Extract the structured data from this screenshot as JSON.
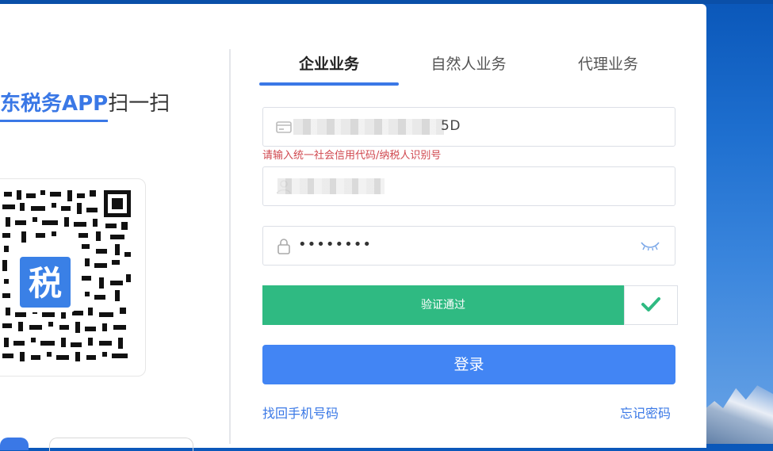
{
  "left_panel": {
    "brand_text": "东税务APP",
    "scan_text": "扫一扫",
    "qr_badge_glyph": "税"
  },
  "tabs": [
    {
      "label": "企业业务",
      "active": true
    },
    {
      "label": "自然人业务",
      "active": false
    },
    {
      "label": "代理业务",
      "active": false
    }
  ],
  "form": {
    "credit_code": {
      "icon": "id-card-icon",
      "visible_value_suffix": "5D"
    },
    "credit_code_error": "请输入统一社会信用代码/纳税人识别号",
    "username": {
      "icon": "user-icon"
    },
    "password": {
      "icon": "lock-icon",
      "masked_value": "••••••••",
      "toggle_icon": "eye-closed-icon"
    },
    "verify": {
      "label": "验证通过",
      "check_icon": "check-icon"
    },
    "login_button": "登录",
    "links": {
      "recover_phone": "找回手机号码",
      "forgot_password": "忘记密码"
    }
  },
  "colors": {
    "accent": "#3a78e6",
    "login_button": "#4285f4",
    "verify_success": "#2fba82",
    "error": "#d0484f"
  }
}
